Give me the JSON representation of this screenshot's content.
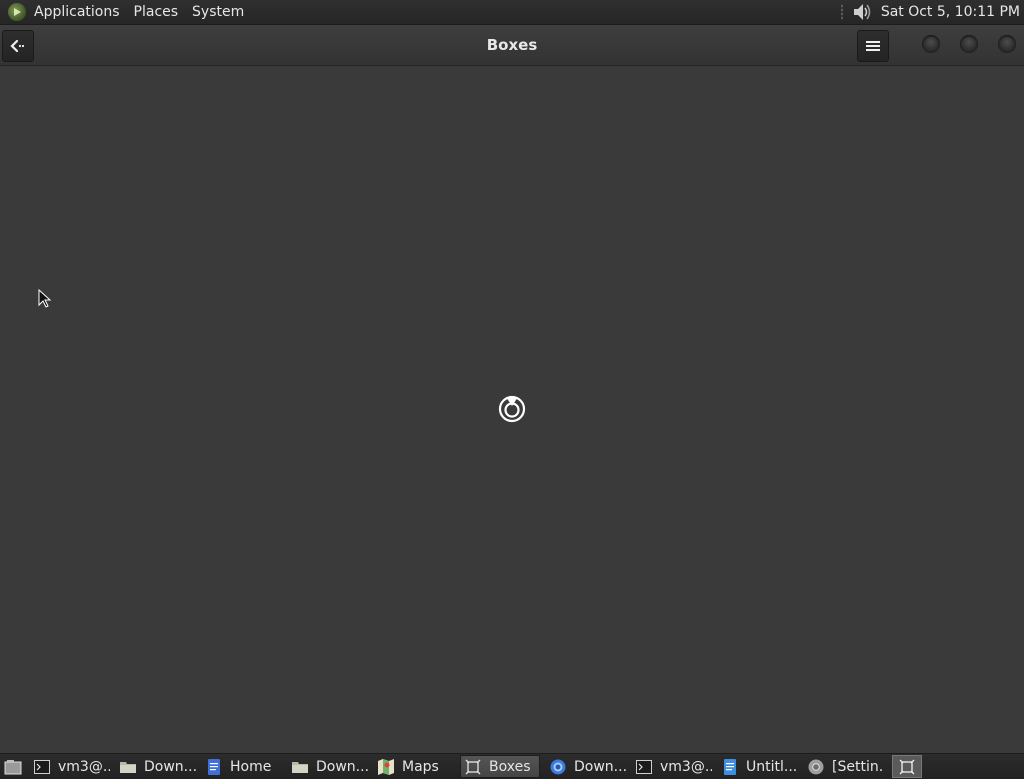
{
  "top_panel": {
    "menus": [
      "Applications",
      "Places",
      "System"
    ],
    "clock": "Sat Oct  5, 10:11 PM"
  },
  "window": {
    "title": "Boxes",
    "back_icon": "back-arrow-icon",
    "menu_icon": "hamburger-icon"
  },
  "content": {
    "spinner_icon": "loading-spinner-icon"
  },
  "taskbar": {
    "tasks": [
      {
        "label": "vm3@...",
        "icon": "terminal-icon",
        "active": false
      },
      {
        "label": "Down...",
        "icon": "folder-icon",
        "active": false
      },
      {
        "label": "Home",
        "icon": "document-icon",
        "active": false
      },
      {
        "label": "Down...",
        "icon": "folder-icon",
        "active": false
      },
      {
        "label": "Maps",
        "icon": "maps-icon",
        "active": false
      },
      {
        "label": "Boxes",
        "icon": "boxes-icon",
        "active": true
      },
      {
        "label": "Down...",
        "icon": "browser-icon",
        "active": false
      },
      {
        "label": "vm3@...",
        "icon": "terminal-icon",
        "active": false
      },
      {
        "label": "Untitl...",
        "icon": "document-icon",
        "active": false
      },
      {
        "label": "[Settin...",
        "icon": "chrome-icon",
        "active": false
      }
    ]
  },
  "colors": {
    "background": "#3a3a3a",
    "panel": "#262626",
    "text": "#e6e6e6"
  }
}
